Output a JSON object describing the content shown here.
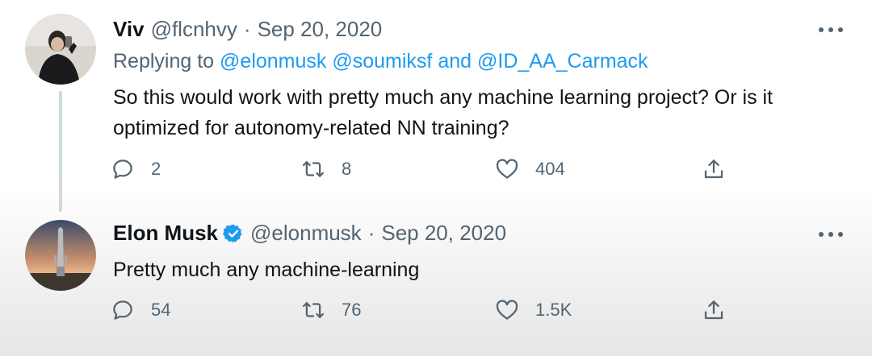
{
  "tweets": [
    {
      "name": "Viv",
      "handle": "@flcnhvy",
      "separator": "·",
      "date": "Sep 20, 2020",
      "replying_prefix": "Replying to",
      "mentions": [
        "@elonmusk",
        "@soumiksf",
        "@ID_AA_Carmack"
      ],
      "mention_joiner": "and",
      "text": "So this would work with pretty much any machine learning project? Or is it optimized for autonomy-related NN training?",
      "replies": "2",
      "retweets": "8",
      "likes": "404"
    },
    {
      "name": "Elon Musk",
      "verified": true,
      "handle": "@elonmusk",
      "separator": "·",
      "date": "Sep 20, 2020",
      "text": "Pretty much any machine-learning",
      "replies": "54",
      "retweets": "76",
      "likes": "1.5K"
    }
  ],
  "icons": {
    "reply": "reply-icon",
    "retweet": "retweet-icon",
    "like": "heart-icon",
    "share": "share-icon",
    "more": "more-icon",
    "verified": "verified-badge-icon"
  },
  "colors": {
    "accent": "#1d9bf0",
    "secondary_text": "#536471",
    "primary_text": "#0f1419",
    "thread_line": "#cfd9de"
  }
}
